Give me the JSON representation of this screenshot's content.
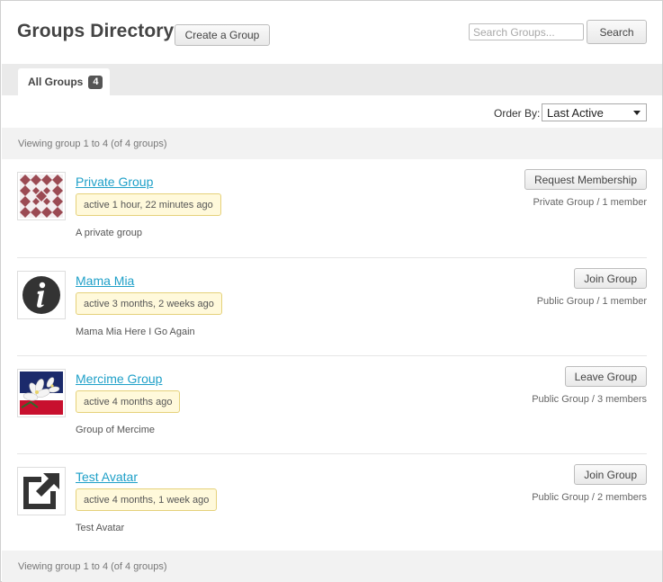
{
  "header": {
    "title": "Groups Directory",
    "create_label": "Create a Group",
    "search_placeholder": "Search Groups...",
    "search_label": "Search"
  },
  "tabs": [
    {
      "label": "All Groups",
      "count": "4"
    }
  ],
  "order": {
    "label": "Order By:",
    "selected": "Last Active"
  },
  "pagination": {
    "text": "Viewing group 1 to 4 (of 4 groups)"
  },
  "groups": [
    {
      "name": "Private Group",
      "activity": "active 1 hour, 22 minutes ago",
      "description": "A private group",
      "action": "Request Membership",
      "meta": "Private Group / 1 member",
      "avatar_icon": "pattern-avatar-icon"
    },
    {
      "name": "Mama Mia",
      "activity": "active 3 months, 2 weeks ago",
      "description": "Mama Mia Here I Go Again",
      "action": "Join Group",
      "meta": "Public Group / 1 member",
      "avatar_icon": "info-icon"
    },
    {
      "name": "Mercime Group",
      "activity": "active 4 months ago",
      "description": "Group of Mercime",
      "action": "Leave Group",
      "meta": "Public Group / 3 members",
      "avatar_icon": "flower-photo-icon"
    },
    {
      "name": "Test Avatar",
      "activity": "active 4 months, 1 week ago",
      "description": "Test Avatar",
      "action": "Join Group",
      "meta": "Public Group / 2 members",
      "avatar_icon": "external-link-icon"
    }
  ],
  "colors": {
    "link": "#1fa0c8",
    "activity_bg": "#fff9db",
    "activity_border": "#e5d17a",
    "avatar_pattern": "#9b4a53"
  }
}
